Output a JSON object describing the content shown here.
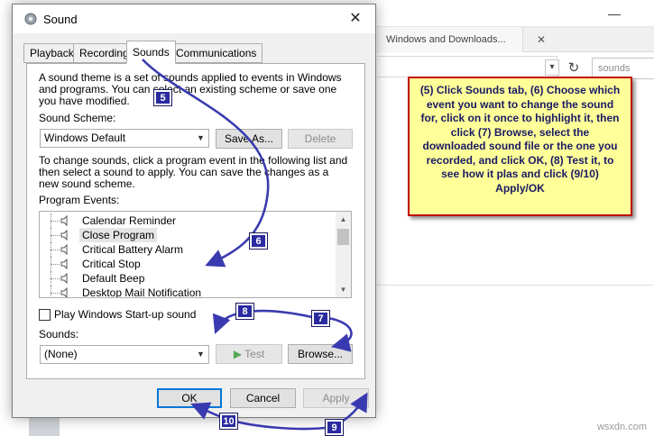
{
  "background_window": {
    "tab_title": "Windows and Downloads...",
    "search_placeholder": "sounds",
    "minimize_glyph": "—",
    "tab_close_glyph": "✕"
  },
  "dialog": {
    "title": "Sound",
    "close_glyph": "✕",
    "tabs": [
      {
        "label": "Playback"
      },
      {
        "label": "Recording"
      },
      {
        "label": "Sounds"
      },
      {
        "label": "Communications"
      }
    ],
    "description": "A sound theme is a set of sounds applied to events in Windows and programs.  You can select an existing scheme or save one you have modified.",
    "scheme_label": "Sound Scheme:",
    "scheme_value": "Windows Default",
    "save_as_label": "Save As...",
    "delete_label": "Delete",
    "instructions": "To change sounds, click a program event in the following list and then select a sound to apply.  You can save the changes as a new sound scheme.",
    "program_events_label": "Program Events:",
    "events": [
      {
        "label": "Calendar Reminder"
      },
      {
        "label": "Close Program"
      },
      {
        "label": "Critical Battery Alarm"
      },
      {
        "label": "Critical Stop"
      },
      {
        "label": "Default Beep"
      },
      {
        "label": "Desktop Mail Notification"
      }
    ],
    "startup_label": "Play Windows Start-up sound",
    "sounds_label": "Sounds:",
    "sounds_value": "(None)",
    "test_label": "Test",
    "browse_label": "Browse...",
    "ok_label": "OK",
    "cancel_label": "Cancel",
    "apply_label": "Apply"
  },
  "callout": {
    "text": "(5) Click Sounds tab, (6) Choose which event you want to change the sound for, click on it once to highlight it, then click (7) Browse, select the downloaded sound file or the one you recorded, and click OK, (8) Test it, to see how it plas and click (9/10) Apply/OK"
  },
  "badges": {
    "b5": "5",
    "b6": "6",
    "b7": "7",
    "b8": "8",
    "b9": "9",
    "b10": "10"
  },
  "colors": {
    "annotation_arrow": "#3a3ab0",
    "callout_bg": "#ffff99",
    "callout_border": "#c00000",
    "selection": "#e5e5e5",
    "focus_border": "#0078d7"
  },
  "watermark": "wsxdn.com"
}
